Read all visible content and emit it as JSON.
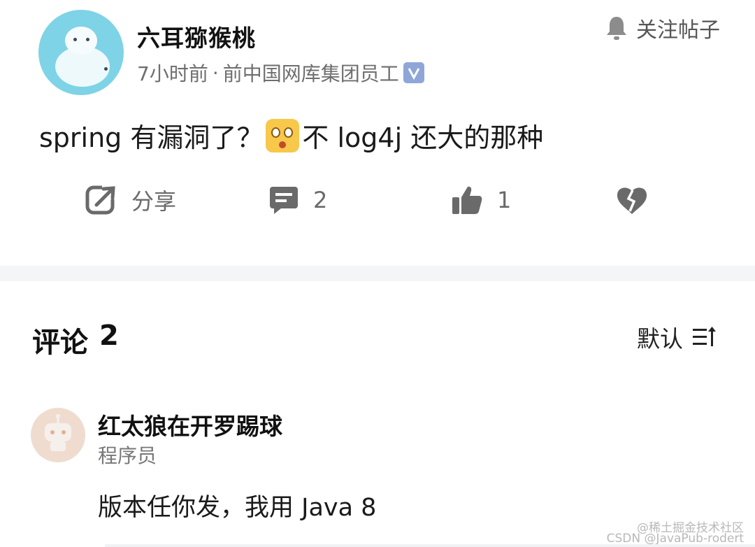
{
  "post": {
    "author": "六耳猕猴桃",
    "time": "7小时前",
    "separator": "·",
    "affiliation": "前中国网库集团员工",
    "follow_label": "关注帖子",
    "content_before": "spring 有漏洞了？",
    "content_after": "不 log4j 还大的那种",
    "emoji_icon": "scared-face-emoji"
  },
  "actions": {
    "share_label": "分享",
    "comment_count": "2",
    "like_count": "1"
  },
  "comments_section": {
    "title": "评论",
    "count": "2",
    "sort_label": "默认"
  },
  "comment": {
    "name": "红太狼在开罗踢球",
    "role": "程序员",
    "text": "版本任你发，我用 Java 8"
  },
  "watermark": {
    "line1": "@稀土掘金技术社区",
    "line2": "CSDN @JavaPub-rodert"
  },
  "colors": {
    "accent_avatar": "#7fd3e6",
    "verified_badge": "#8fa6d8",
    "icon_gray": "#6a6a6a"
  }
}
